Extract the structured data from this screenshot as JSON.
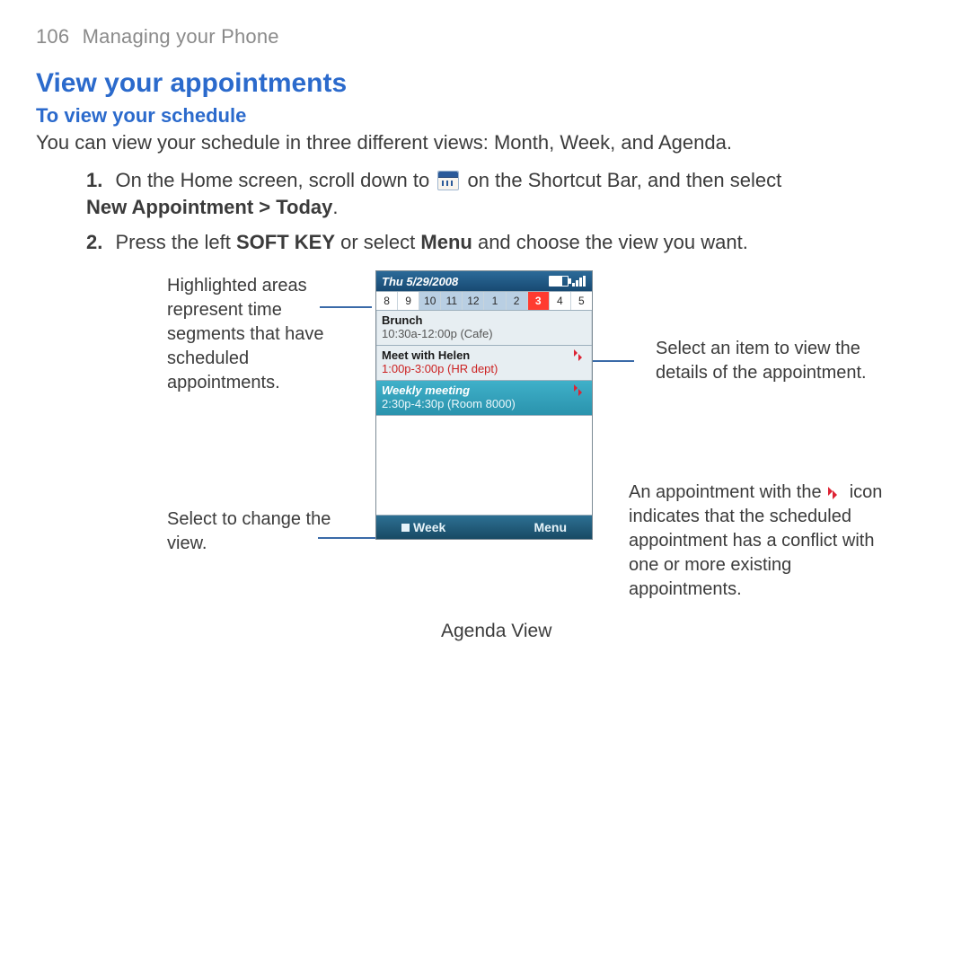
{
  "page": {
    "number": "106",
    "section": "Managing your Phone"
  },
  "h1": "View your appointments",
  "h2": "To view your schedule",
  "intro": "You can view your schedule in three different views: Month, Week, and Agenda.",
  "steps": {
    "s1a": "On the Home screen, scroll down to",
    "s1b": "on the Shortcut Bar, and then select",
    "s1c": "New Appointment > Today",
    "s2a": "Press the left ",
    "s2b": "SOFT KEY",
    "s2c": " or select ",
    "s2d": "Menu",
    "s2e": " and choose the view you want."
  },
  "callouts": {
    "left1": "Highlighted areas represent time segments that have scheduled appointments.",
    "left2": "Select to change the view.",
    "right1": "Select an item to view the details of the appointment.",
    "right2a": "An appointment with the",
    "right2b": "icon indicates that the scheduled appointment has a conflict with one or more existing appointments."
  },
  "caption": "Agenda View",
  "phone": {
    "title": "Thu 5/29/2008",
    "hours": [
      "8",
      "9",
      "10",
      "11",
      "12",
      "1",
      "2",
      "3",
      "4",
      "5"
    ],
    "highlight": [
      2,
      3,
      4,
      5,
      6
    ],
    "selected": 7,
    "appointments": [
      {
        "title": "Brunch",
        "time": "10:30a-12:00p (Cafe)",
        "conflict": false,
        "timeRed": false
      },
      {
        "title": "Meet with Helen",
        "time": "1:00p-3:00p (HR dept)",
        "conflict": true,
        "timeRed": true
      },
      {
        "title": "Weekly meeting",
        "time": "2:30p-4:30p (Room 8000)",
        "conflict": true,
        "selected": true
      }
    ],
    "soft": {
      "left": "Week",
      "right": "Menu"
    }
  }
}
